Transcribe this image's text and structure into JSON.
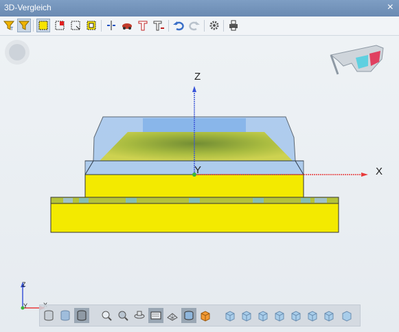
{
  "window": {
    "title": "3D-Vergleich",
    "close_glyph": "×"
  },
  "toolbar": {
    "buttons": [
      {
        "name": "filter-icon"
      },
      {
        "name": "filter-active-icon"
      },
      {
        "name": "select-box-icon"
      },
      {
        "name": "select-red-icon"
      },
      {
        "name": "select-outline-icon"
      },
      {
        "name": "select-yellow-icon"
      },
      {
        "name": "section-icon"
      },
      {
        "name": "car-icon"
      },
      {
        "name": "t-tool-icon"
      },
      {
        "name": "t-tool-sub-icon"
      },
      {
        "name": "undo-icon"
      },
      {
        "name": "redo-icon"
      },
      {
        "name": "gear-icon"
      },
      {
        "name": "printer-icon"
      }
    ]
  },
  "viewport": {
    "axes": {
      "z": "Z",
      "y": "Y",
      "x": "X"
    },
    "triad": {
      "z": "Z",
      "y": "Y",
      "x": "X"
    },
    "colors": {
      "yellow": "#f3ea00",
      "olive": "#b4c23a",
      "blue_transparent": "#9bc1ec",
      "x_axis": "#e83a3a",
      "z_axis": "#3a55d8"
    }
  },
  "bottombar": {
    "buttons": [
      {
        "name": "cylinder-grey-icon"
      },
      {
        "name": "cylinder-blue-icon"
      },
      {
        "name": "cylinder-dark-icon"
      },
      {
        "name": "zoom-icon"
      },
      {
        "name": "zoom-fit-icon"
      },
      {
        "name": "rotate-icon"
      },
      {
        "name": "keyboard-icon"
      },
      {
        "name": "wireframe-icon"
      },
      {
        "name": "solid-icon"
      },
      {
        "name": "cube-orange-icon"
      },
      {
        "name": "view-cube-1-icon"
      },
      {
        "name": "view-cube-2-icon"
      },
      {
        "name": "view-cube-3-icon"
      },
      {
        "name": "view-cube-4-icon"
      },
      {
        "name": "view-cube-5-icon"
      },
      {
        "name": "view-cube-6-icon"
      },
      {
        "name": "view-cube-7-icon"
      }
    ]
  }
}
